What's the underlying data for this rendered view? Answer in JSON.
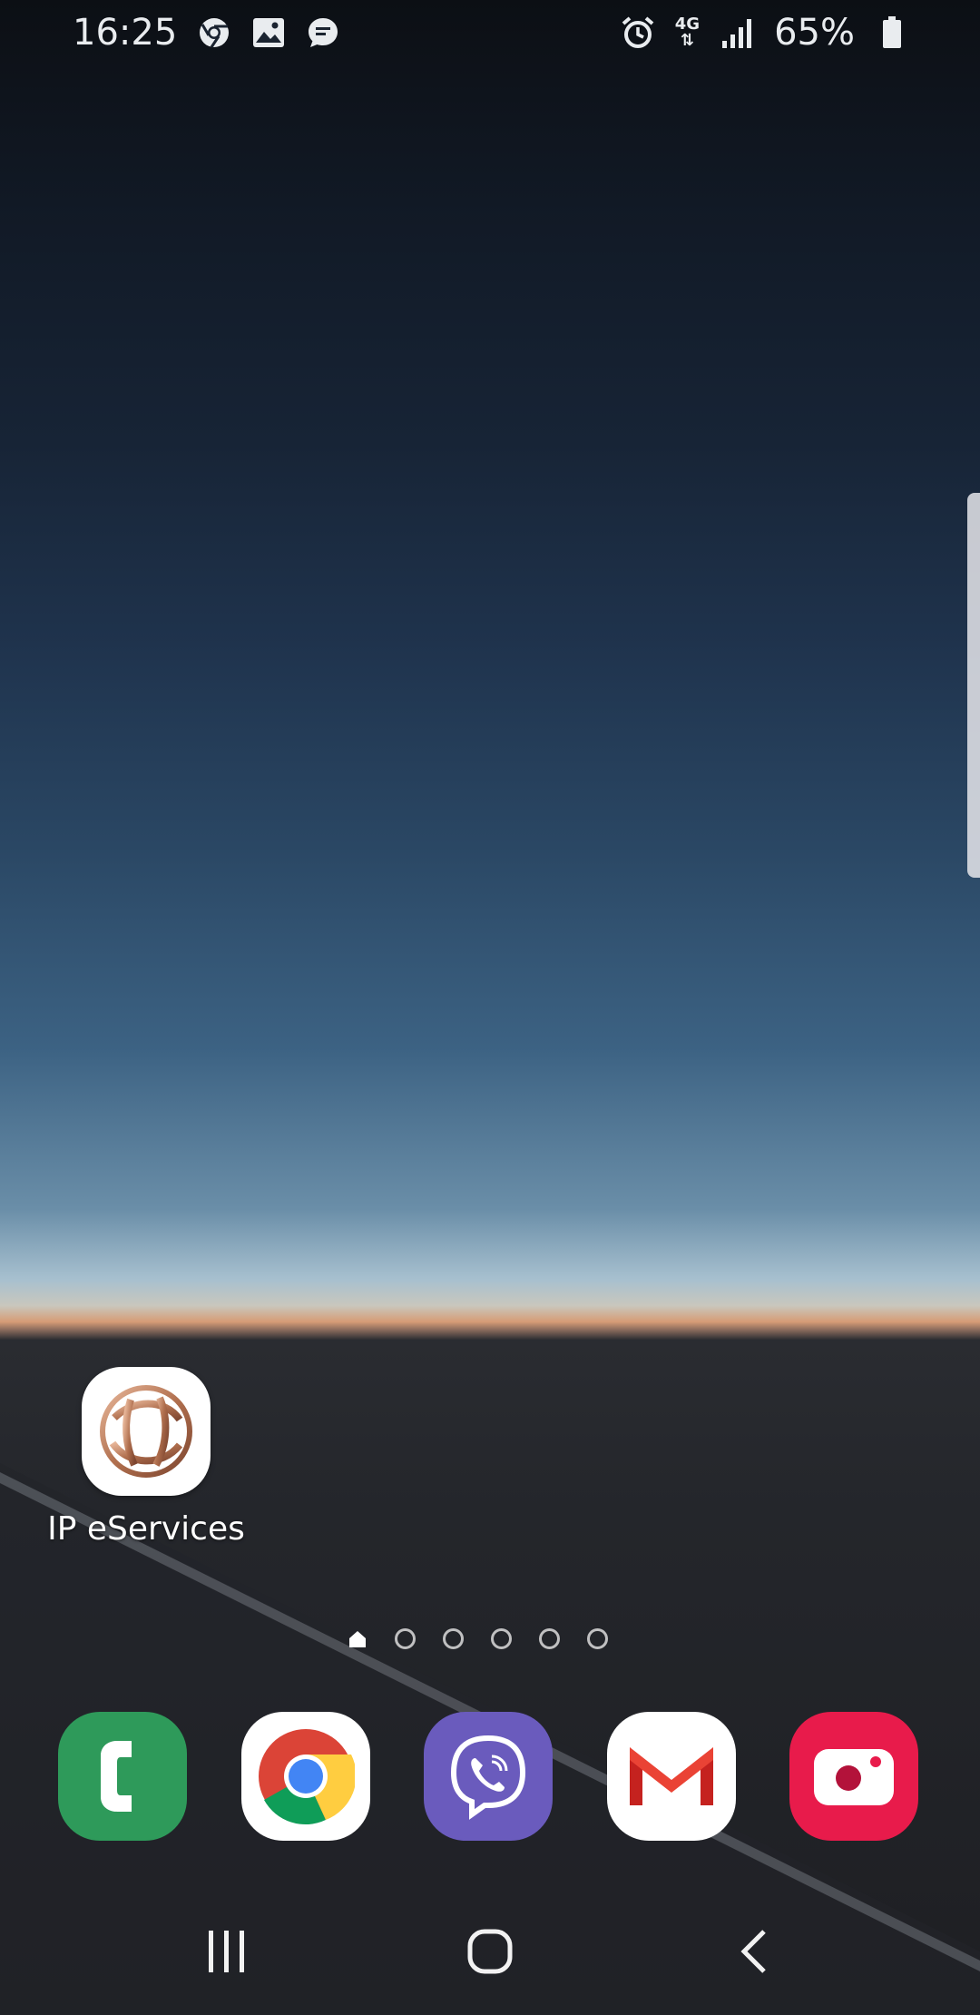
{
  "status_bar": {
    "time": "16:25",
    "left_icons": [
      "chrome-icon",
      "gallery-icon",
      "message-icon"
    ],
    "network_type": "4G",
    "battery_percent": "65%",
    "right_icons": [
      "alarm-icon",
      "data-transfer-icon",
      "signal-icon",
      "battery-icon"
    ]
  },
  "home_screen": {
    "apps": [
      {
        "label": "IP eServices",
        "icon": "ip-eservices-icon"
      }
    ],
    "page_indicator": {
      "total_pages": 6,
      "current_page": 1,
      "home_page": 1
    }
  },
  "dock": {
    "apps": [
      {
        "name": "Phone",
        "icon": "phone-icon",
        "color": "#2e9a5a"
      },
      {
        "name": "Chrome",
        "icon": "chrome-icon",
        "color": "#ffffff"
      },
      {
        "name": "Viber",
        "icon": "viber-icon",
        "color": "#6a5bbd"
      },
      {
        "name": "Gmail",
        "icon": "gmail-icon",
        "color": "#ffffff"
      },
      {
        "name": "Camera",
        "icon": "camera-icon",
        "color": "#e81b4b"
      }
    ]
  },
  "nav_bar": {
    "buttons": [
      "recent-apps-icon",
      "home-icon",
      "back-icon"
    ]
  }
}
